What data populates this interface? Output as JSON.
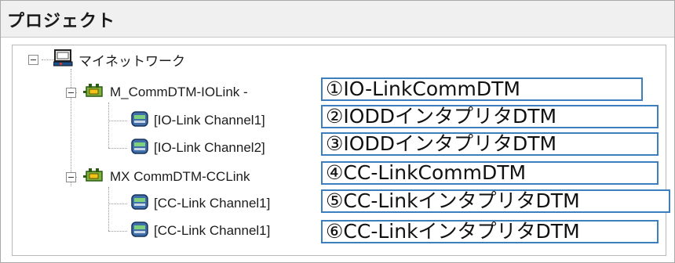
{
  "panel": {
    "title": "プロジェクト"
  },
  "tree": {
    "root": {
      "label": "マイネットワーク"
    },
    "groups": [
      {
        "label": "M_CommDTM-IOLink -",
        "children": [
          "[IO-Link Channel1]",
          "[IO-Link Channel2]"
        ]
      },
      {
        "label": "MX CommDTM-CCLink",
        "children": [
          "[CC-Link Channel1]",
          "[CC-Link Channel1]"
        ]
      }
    ]
  },
  "callouts": [
    "①IO-LinkCommDTM",
    "②IODDインタプリタDTM",
    "③IODDインタプリタDTM",
    "④CC-LinkCommDTM",
    "⑤CC-LinkインタプリタDTM",
    "⑥CC-LinkインタプリタDTM"
  ],
  "colors": {
    "callout_border": "#3d7fbe"
  }
}
